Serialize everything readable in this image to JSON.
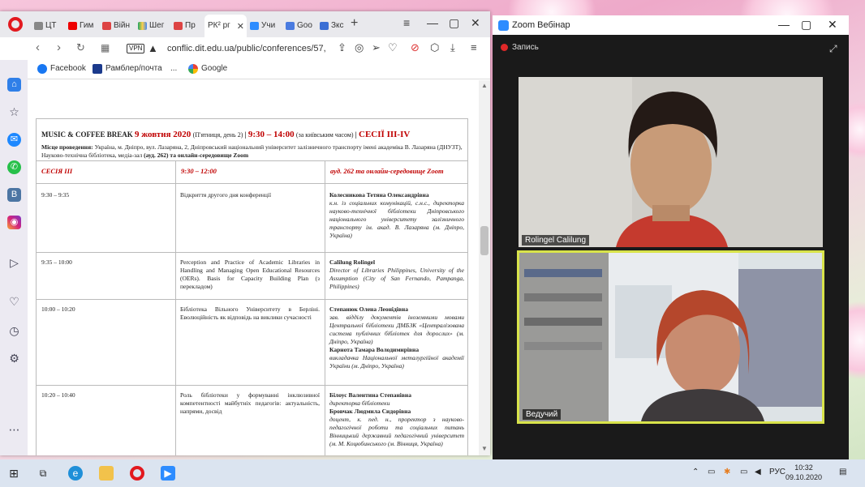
{
  "browser": {
    "tabs": [
      {
        "label": "ЦТ"
      },
      {
        "label": "Гим"
      },
      {
        "label": "Війн"
      },
      {
        "label": "Шег"
      },
      {
        "label": "Пр"
      },
      {
        "label": "РК² рг"
      },
      {
        "label": "Учи"
      },
      {
        "label": "Goo"
      },
      {
        "label": "Зкс"
      }
    ],
    "new_tab": "+",
    "url": "conflic.dit.edu.ua/public/conferences/57,",
    "vpn_label": "VPN",
    "bookmarks": [
      {
        "label": "Facebook"
      },
      {
        "label": "Рамблер/почта"
      },
      {
        "label": "..."
      },
      {
        "label": "Google"
      }
    ]
  },
  "document": {
    "header": {
      "event": "MUSIC & COFFEE BREAK",
      "date": "9 жовтня 2020",
      "day": "(П'ятниця, день 2)",
      "sep1": "|",
      "time": "9:30 – 14:00",
      "tz": "(за київським часом)",
      "sep2": "|",
      "sessions": "СЕСІЇ III-IV",
      "venue_label": "Місце проведення:",
      "venue": "Україна, м. Дніпро, вул. Лазаряна, 2, Дніпровський національний університет залізничного транспорту імені академіка В. Лазаряна (ДНУЗТ), Науково-технічна бібліотека, медіа-зал",
      "room": "(ауд. 262)",
      "online": "та онлайн-середовище Zoom"
    },
    "session_row": {
      "session": "СЕСІЯ III",
      "time": "9:30 – 12:00",
      "place": "ауд. 262   та   онлайн-середовище Zoom"
    },
    "rows": [
      {
        "time": "9:30 – 9:35",
        "title": "Відкриття другого дня конференції",
        "speakers": [
          {
            "name": "Колесникова Тетяна Олександрівна",
            "affiliation": "к.н. із соціальних комунікацій, с.н.с., директорка науково-технічної бібліотеки Дніпровського національного університету залізничного транспорту ім. акад. В. Лазаряна (м. Дніпро, Україна)"
          }
        ]
      },
      {
        "time": "9:35 – 10:00",
        "title": "Perception and Practice of Academic Libraries in Handling and Managing Open Educational Resources (OERs). Basis for Capacity Building Plan (з перекладом)",
        "speakers": [
          {
            "name": "Calilung Rolingel",
            "affiliation": "Director of Libraries Philippines, University of the Assumption (City of San Fernando, Pampanga, Philippines)"
          }
        ]
      },
      {
        "time": "10:00 – 10:20",
        "title": "Бібліотека Вільного Університету в Берліні. Еволюційність як відповідь на виклики сучасності",
        "speakers": [
          {
            "name": "Степанюк Олена Леонідівна",
            "affiliation": "зав. відділу документів іноземними мовами Центральної бібліотеки ДМБЗК «Централізована система публічних бібліотек для дорослих» (м. Дніпро, Україна)"
          },
          {
            "name": "Карнота Тамара Володимирівна",
            "affiliation": "викладачка Національної металургійної академії України (м. Дніпро, Україна)"
          }
        ]
      },
      {
        "time": "10:20 – 10:40",
        "title": "Роль бібліотеки у формуванні інклюзивної компетентності майбутніх педагогів: актуальність, напрями, досвід",
        "speakers": [
          {
            "name": "Білоус Валентина Степанівна",
            "affiliation": "директорка бібліотеки"
          },
          {
            "name": "Бровчак Людмила Сидорівна",
            "affiliation": "доцент, к. пед. н., проректор з науково-педагогічної роботи та соціальних питань Вінницький державний педагогічний університет (м. М. Коцюбинського (м. Вінниця, Україна)"
          }
        ]
      }
    ]
  },
  "zoom": {
    "title": "Zoom Вебінар",
    "record": "Запись",
    "participants": [
      {
        "name": "Rolingel Calilung"
      },
      {
        "name": "Ведучий"
      }
    ]
  },
  "taskbar": {
    "lang": "РУС",
    "time": "10:32",
    "date": "09.10.2020"
  },
  "colors": {
    "accent_red": "#c00000",
    "zoom_blue": "#2d8cff",
    "active_speaker_border": "#d8e34a"
  }
}
